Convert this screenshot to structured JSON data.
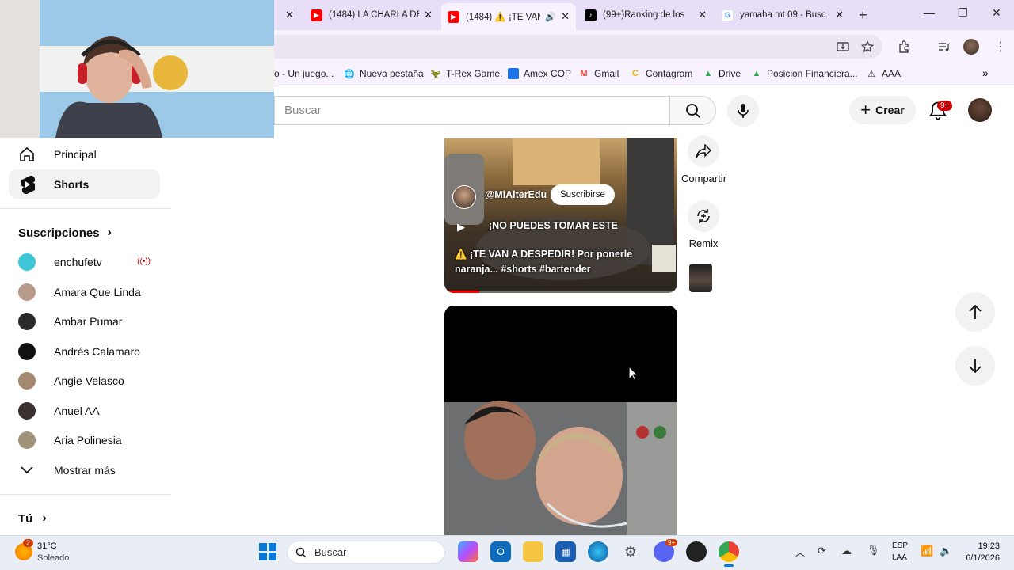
{
  "browser": {
    "tabs": [
      {
        "title": "(1484) LA CHARLA DE",
        "active": false
      },
      {
        "title": "(1484) ⚠️ ¡TE VAN",
        "active": true
      },
      {
        "title": "(99+)Ranking de los",
        "active": false
      },
      {
        "title": "yamaha mt 09 - Busc",
        "active": false
      }
    ],
    "new_tab": "+",
    "bookmarks": [
      {
        "label": "o - Un juego...",
        "icon": "page-icon"
      },
      {
        "label": "Nueva pestaña",
        "icon": "globe-icon"
      },
      {
        "label": "T-Rex Game.",
        "icon": "dino-icon"
      },
      {
        "label": "Amex COP",
        "icon": "amex-icon"
      },
      {
        "label": "Gmail",
        "icon": "gmail-icon"
      },
      {
        "label": "Contagram",
        "icon": "contagram-icon"
      },
      {
        "label": "Drive",
        "icon": "drive-icon"
      },
      {
        "label": "Posicion Financiera...",
        "icon": "drive-icon"
      },
      {
        "label": "AAA",
        "icon": "triangle-icon"
      }
    ]
  },
  "header": {
    "search_placeholder": "Buscar",
    "create_label": "Crear",
    "notif_badge": "9+"
  },
  "sidebar": {
    "main": [
      {
        "label": "Principal",
        "icon": "home-icon"
      },
      {
        "label": "Shorts",
        "icon": "shorts-icon",
        "active": true
      }
    ],
    "subs_title": "Suscripciones",
    "subs": [
      {
        "label": "enchufetv",
        "live": true,
        "color": "#3cc6d6"
      },
      {
        "label": "Amara Que Linda",
        "color": "#b79a8a"
      },
      {
        "label": "Ambar Pumar",
        "color": "#2a2a2a"
      },
      {
        "label": "Andrés Calamaro",
        "color": "#111111"
      },
      {
        "label": "Angie Velasco",
        "color": "#a58870"
      },
      {
        "label": "Anuel AA",
        "color": "#3a3030"
      },
      {
        "label": "Aria Polinesia",
        "color": "#a0937a"
      }
    ],
    "show_more": "Mostrar más",
    "you_label": "Tú"
  },
  "short": {
    "channel": "@MiAlterEdu",
    "subscribe": "Suscribirse",
    "playlist_text": "¡NO PUEDES TOMAR ESTE",
    "caption": "⚠️ ¡TE VAN A DESPEDIR! Por ponerle naranja... #shorts #bartender",
    "progress": 0.15,
    "share_label": "Compartir",
    "remix_label": "Remix"
  },
  "taskbar": {
    "weather_temp": "31°C",
    "weather_desc": "Soleado",
    "weather_badge": "2",
    "search_label": "Buscar",
    "lang_1": "ESP",
    "lang_2": "LAA",
    "time": "19:23",
    "date": "6/1/2026",
    "discord_badge": "9+"
  }
}
